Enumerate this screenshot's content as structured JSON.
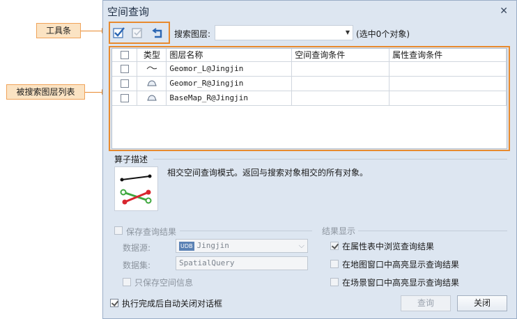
{
  "annotations": {
    "toolbar_label": "工具条",
    "layer_list_label": "被搜索图层列表"
  },
  "colors": {
    "callout_border": "#e88a2e",
    "callout_fill": "#fbe3c3",
    "dialog_bg": "#dde6f1"
  },
  "dialog": {
    "title": "空间查询",
    "close_symbol": "✕"
  },
  "toolbar": {
    "buttons": [
      "select-all-icon",
      "select-none-icon",
      "invert-selection-icon"
    ]
  },
  "search": {
    "label": "搜索图层:",
    "value": "",
    "selection_status": "(选中0个对象)"
  },
  "layer_table": {
    "headers": [
      "",
      "类型",
      "图层名称",
      "空间查询条件",
      "属性查询条件"
    ],
    "rows": [
      {
        "checked": false,
        "type": "line",
        "name": "Geomor_L@Jingjin",
        "spatial": "",
        "attribute": ""
      },
      {
        "checked": false,
        "type": "region",
        "name": "Geomor_R@Jingjin",
        "spatial": "",
        "attribute": ""
      },
      {
        "checked": false,
        "type": "region",
        "name": "BaseMap_R@Jingjin",
        "spatial": "",
        "attribute": ""
      }
    ]
  },
  "operator": {
    "section_title": "算子描述",
    "description": "相交空间查询模式。返回与搜索对象相交的所有对象。"
  },
  "save_results": {
    "title": "保存查询结果",
    "checked": false,
    "datasource_label": "数据源:",
    "datasource_badge": "UDB",
    "datasource_value": "Jingjin",
    "dataset_label": "数据集:",
    "dataset_value": "SpatialQuery",
    "spatial_only_label": "只保存空间信息",
    "spatial_only_checked": false
  },
  "result_display": {
    "title": "结果显示",
    "options": [
      {
        "label": "在属性表中浏览查询结果",
        "checked": true
      },
      {
        "label": "在地图窗口中高亮显示查询结果",
        "checked": false
      },
      {
        "label": "在场景窗口中高亮显示查询结果",
        "checked": false
      }
    ]
  },
  "footer": {
    "auto_close_label": "执行完成后自动关闭对话框",
    "auto_close_checked": true,
    "query_button": "查询",
    "close_button": "关闭"
  }
}
